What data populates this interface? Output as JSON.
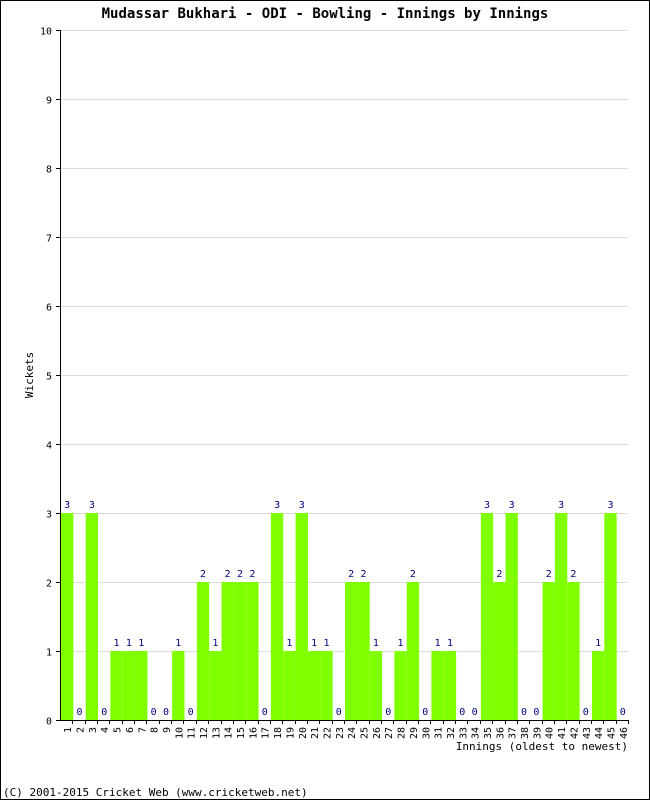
{
  "chart_data": {
    "type": "bar",
    "title": "Mudassar Bukhari - ODI - Bowling - Innings by Innings",
    "xlabel": "Innings (oldest to newest)",
    "ylabel": "Wickets",
    "ylim": [
      0,
      10
    ],
    "yticks": [
      0,
      1,
      2,
      3,
      4,
      5,
      6,
      7,
      8,
      9,
      10
    ],
    "grid": true,
    "categories": [
      "1",
      "2",
      "3",
      "4",
      "5",
      "6",
      "7",
      "8",
      "9",
      "10",
      "11",
      "12",
      "13",
      "14",
      "15",
      "16",
      "17",
      "18",
      "19",
      "20",
      "21",
      "22",
      "23",
      "24",
      "25",
      "26",
      "27",
      "28",
      "29",
      "30",
      "31",
      "32",
      "33",
      "34",
      "35",
      "36",
      "37",
      "38",
      "39",
      "40",
      "41",
      "42",
      "43",
      "44",
      "45",
      "46"
    ],
    "values": [
      3,
      0,
      3,
      0,
      1,
      1,
      1,
      0,
      0,
      1,
      0,
      2,
      1,
      2,
      2,
      2,
      0,
      3,
      1,
      3,
      1,
      1,
      0,
      2,
      2,
      1,
      0,
      1,
      2,
      0,
      1,
      1,
      0,
      0,
      3,
      2,
      3,
      0,
      0,
      2,
      3,
      2,
      0,
      1,
      3,
      0
    ],
    "bar_color": "#80ff00",
    "label_color": "#000080"
  },
  "footer": "(C) 2001-2015 Cricket Web (www.cricketweb.net)"
}
